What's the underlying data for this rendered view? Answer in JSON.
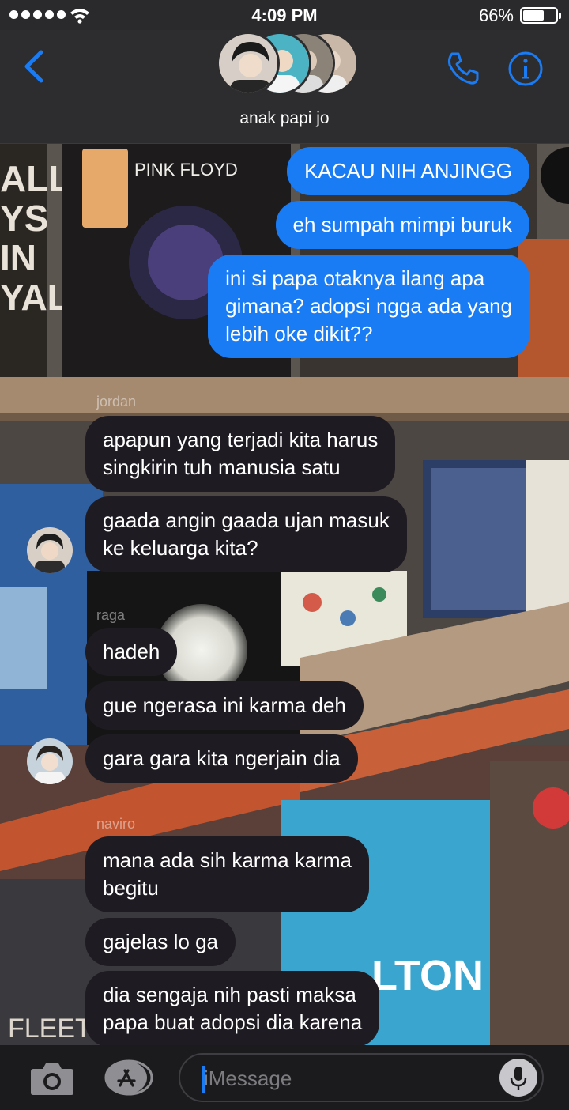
{
  "status_bar": {
    "time": "4:09 PM",
    "battery": "66%",
    "battery_level": 0.66,
    "signal_bars": 5,
    "wifi_icon": "wifi-icon"
  },
  "header": {
    "group_name": "anak papi jo",
    "back_icon": "chevron-left-icon",
    "call_icon": "phone-icon",
    "info_icon": "info-icon",
    "accent_color": "#1a7cf5"
  },
  "messages": {
    "sent": [
      "KACAU NIH ANJINGG",
      "eh sumpah mimpi buruk",
      "ini si papa otaknya ilang apa\ngimana? adopsi ngga ada yang\nlebih oke dikit??"
    ],
    "jordan": {
      "name": "jordan",
      "texts": [
        "apapun yang terjadi kita harus\nsingkirin tuh manusia satu",
        "gaada angin gaada ujan masuk\nke keluarga kita?"
      ]
    },
    "raga": {
      "name": "raga",
      "texts": [
        "hadeh",
        "gue ngerasa ini karma deh",
        "gara gara kita ngerjain dia"
      ]
    },
    "naviro": {
      "name": "naviro",
      "texts": [
        "mana ada sih karma karma\nbegitu",
        "gajelas lo ga",
        "dia sengaja nih pasti maksa\npapa buat adopsi dia karena"
      ]
    }
  },
  "input_bar": {
    "placeholder": "iMessage",
    "camera_icon": "camera-icon",
    "apps_icon": "app-store-icon",
    "mic_icon": "microphone-icon"
  },
  "colors": {
    "sent_bubble": "#1a7cf5",
    "received_bubble": "#1f1b22",
    "header_bg": "#2d2d2f"
  }
}
